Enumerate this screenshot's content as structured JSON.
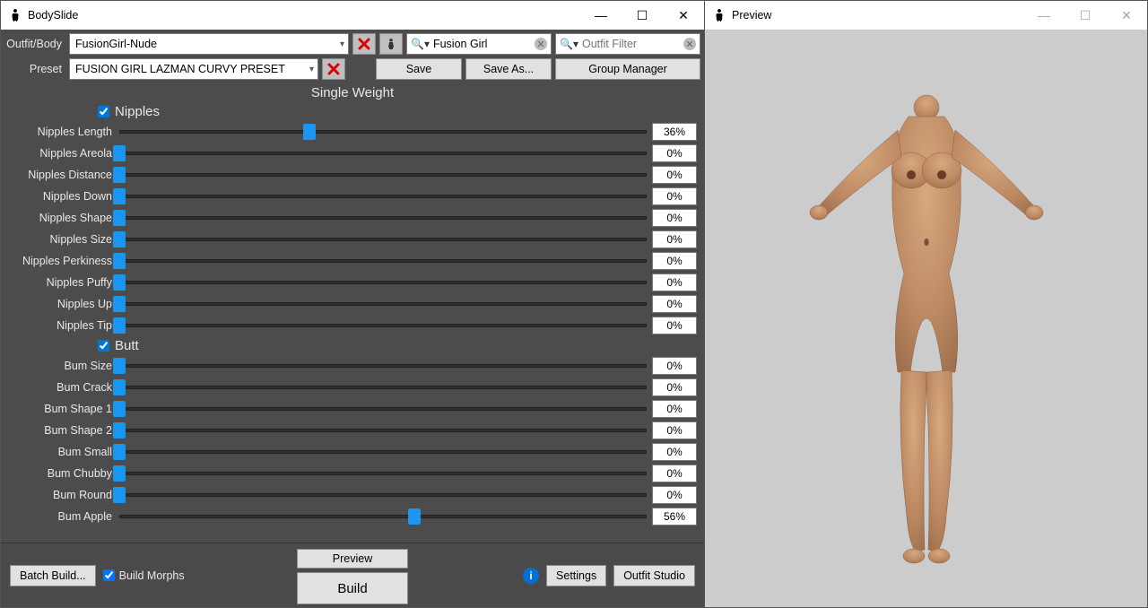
{
  "mainWindow": {
    "title": "BodySlide",
    "controls": {
      "min": "—",
      "max": "☐",
      "close": "✕"
    }
  },
  "previewWindow": {
    "title": "Preview",
    "controls": {
      "min": "—",
      "max": "☐",
      "close": "✕"
    }
  },
  "toolbar": {
    "outfitLabel": "Outfit/Body",
    "outfitValue": "FusionGirl-Nude",
    "groupFilterValue": "Fusion Girl",
    "outfitFilterPlaceholder": "Outfit Filter",
    "presetLabel": "Preset",
    "presetValue": "FUSION GIRL LAZMAN CURVY PRESET",
    "save": "Save",
    "saveAs": "Save As...",
    "groupManager": "Group Manager"
  },
  "weightHeader": "Single Weight",
  "groups": [
    {
      "name": "Nipples",
      "checked": true,
      "sliders": [
        {
          "label": "Nipples Length",
          "value": 36
        },
        {
          "label": "Nipples Areola",
          "value": 0
        },
        {
          "label": "Nipples Distance",
          "value": 0
        },
        {
          "label": "Nipples Down",
          "value": 0
        },
        {
          "label": "Nipples Shape",
          "value": 0
        },
        {
          "label": "Nipples Size",
          "value": 0
        },
        {
          "label": "Nipples Perkiness",
          "value": 0
        },
        {
          "label": "Nipples Puffy",
          "value": 0
        },
        {
          "label": "Nipples Up",
          "value": 0
        },
        {
          "label": "Nipples Tip",
          "value": 0
        }
      ]
    },
    {
      "name": "Butt",
      "checked": true,
      "sliders": [
        {
          "label": "Bum Size",
          "value": 0
        },
        {
          "label": "Bum Crack",
          "value": 0
        },
        {
          "label": "Bum Shape 1",
          "value": 0
        },
        {
          "label": "Bum Shape 2",
          "value": 0
        },
        {
          "label": "Bum Small",
          "value": 0
        },
        {
          "label": "Bum Chubby",
          "value": 0
        },
        {
          "label": "Bum Round",
          "value": 0
        },
        {
          "label": "Bum Apple",
          "value": 56
        }
      ]
    }
  ],
  "footer": {
    "batchBuild": "Batch Build...",
    "buildMorphs": "Build Morphs",
    "buildMorphsChecked": true,
    "preview": "Preview",
    "build": "Build",
    "settings": "Settings",
    "outfitStudio": "Outfit Studio"
  }
}
